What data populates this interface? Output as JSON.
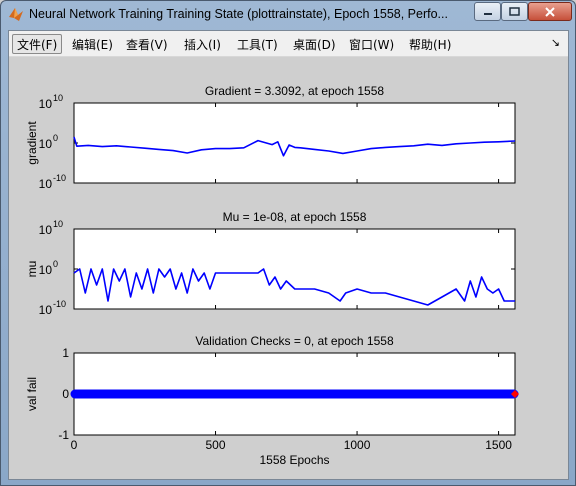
{
  "window": {
    "title": "Neural Network Training Training State (plottrainstate), Epoch 1558, Perfo...",
    "app_icon": "matlab-logo-icon",
    "controls": {
      "minimize": "minimize-icon",
      "maximize": "maximize-icon",
      "close": "close-icon"
    }
  },
  "menu": {
    "items": [
      "文件(F)",
      "编辑(E)",
      "查看(V)",
      "插入(I)",
      "工具(T)",
      "桌面(D)",
      "窗口(W)",
      "帮助(H)"
    ],
    "grip": "↘"
  },
  "colors": {
    "line": "#0000ff",
    "marker": "#ff0000",
    "axes_bg": "#ffffff",
    "figure_bg": "#cfcfcf"
  },
  "chart_data": [
    {
      "type": "line",
      "title": "Gradient = 3.3092, at epoch 1558",
      "ylabel": "gradient",
      "xlabel": "",
      "xlim": [
        0,
        1558
      ],
      "ylim_log10": [
        -10,
        10
      ],
      "y_scale": "log",
      "yticks": [
        {
          "base": "10",
          "exp": "10"
        },
        {
          "base": "10",
          "exp": "0"
        },
        {
          "base": "10",
          "exp": "-10"
        }
      ],
      "series": [
        {
          "x": [
            0,
            10,
            50,
            100,
            150,
            200,
            250,
            300,
            350,
            400,
            450,
            500,
            550,
            600,
            650,
            700,
            720,
            740,
            760,
            780,
            800,
            850,
            900,
            950,
            1000,
            1050,
            1100,
            1150,
            1200,
            1250,
            1300,
            1350,
            1400,
            1450,
            1500,
            1558
          ],
          "y_log10": [
            1.5,
            -0.8,
            -0.6,
            -0.9,
            -0.7,
            -1.0,
            -1.3,
            -1.6,
            -1.9,
            -2.5,
            -1.7,
            -1.4,
            -1.4,
            -1.2,
            0.6,
            -0.4,
            0.3,
            -3.2,
            -0.5,
            -1.1,
            -1.2,
            -1.6,
            -2.0,
            -2.6,
            -2.0,
            -1.4,
            -1.1,
            -0.9,
            -0.7,
            -0.3,
            -0.6,
            -0.2,
            0.0,
            0.2,
            0.3,
            0.5
          ]
        }
      ]
    },
    {
      "type": "line",
      "title": "Mu = 1e-08, at epoch 1558",
      "ylabel": "mu",
      "xlabel": "",
      "xlim": [
        0,
        1558
      ],
      "ylim_log10": [
        -10,
        10
      ],
      "y_scale": "log",
      "yticks": [
        {
          "base": "10",
          "exp": "10"
        },
        {
          "base": "10",
          "exp": "0"
        },
        {
          "base": "10",
          "exp": "-10"
        }
      ],
      "series": [
        {
          "x": [
            0,
            20,
            40,
            60,
            80,
            100,
            120,
            140,
            160,
            180,
            200,
            220,
            240,
            260,
            280,
            300,
            320,
            340,
            360,
            380,
            400,
            420,
            440,
            460,
            480,
            500,
            550,
            600,
            650,
            670,
            690,
            710,
            730,
            750,
            780,
            800,
            850,
            900,
            940,
            960,
            1000,
            1050,
            1100,
            1150,
            1200,
            1250,
            1300,
            1350,
            1380,
            1400,
            1420,
            1440,
            1460,
            1480,
            1500,
            1520,
            1558
          ],
          "y_log10": [
            -1,
            0,
            -6,
            0,
            -4,
            0,
            -8,
            0,
            -3,
            0,
            -7,
            -1,
            -5,
            0,
            -6,
            0,
            -2,
            0,
            -5,
            -1,
            -6,
            0,
            -3,
            -1,
            -5,
            -1,
            -1,
            -1,
            -1,
            0,
            -4,
            -2,
            -5,
            -3,
            -5,
            -5,
            -5,
            -6,
            -8,
            -6,
            -5,
            -6,
            -6,
            -7,
            -8,
            -9,
            -7,
            -5,
            -8,
            -3,
            -7,
            -2,
            -5,
            -6,
            -5,
            -8,
            -8
          ]
        }
      ]
    },
    {
      "type": "scatter",
      "title": "Validation Checks = 0, at epoch 1558",
      "ylabel": "val fail",
      "xlabel": "1558 Epochs",
      "xlim": [
        0,
        1558
      ],
      "ylim": [
        -1,
        1
      ],
      "yticks": [
        "1",
        "0",
        "-1"
      ],
      "xticks": [
        "0",
        "500",
        "1000",
        "1500"
      ],
      "series": [
        {
          "x_range": [
            0,
            1558
          ],
          "y": 0,
          "last_point": {
            "x": 1558,
            "y": 0
          }
        }
      ]
    }
  ]
}
